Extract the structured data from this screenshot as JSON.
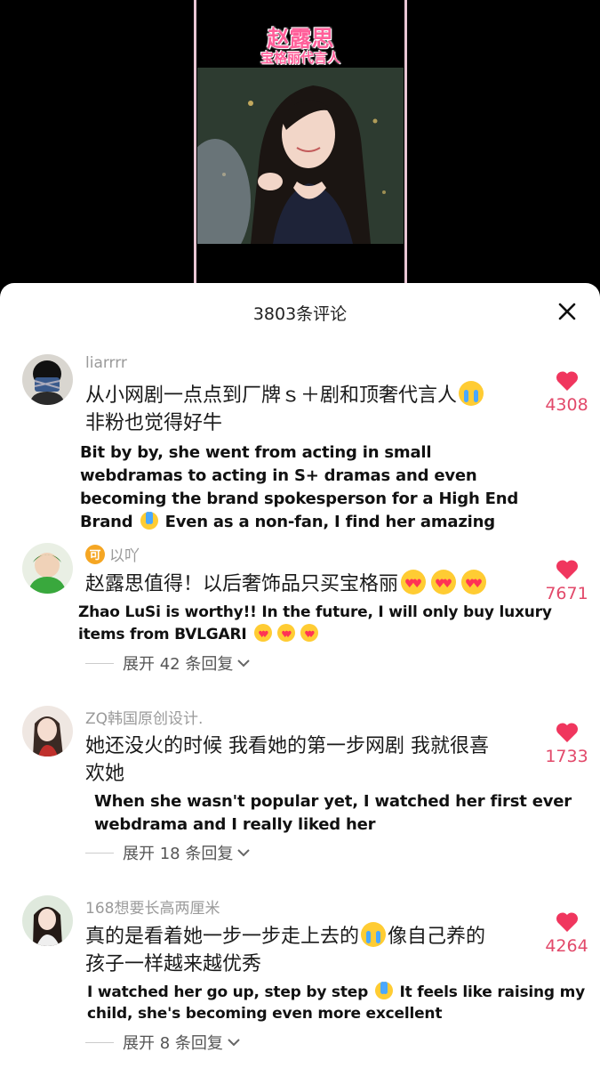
{
  "video": {
    "title": "赵露思",
    "subtitle": "宝格丽代言人"
  },
  "comments_sheet": {
    "title": "3803条评论",
    "close_icon": "close-icon"
  },
  "comments": [
    {
      "username": "liarrrr",
      "text_cn": "从小网剧一点点到厂牌ｓ＋剧和顶奢代言人",
      "text_cn_2": "非粉也觉得好牛",
      "translation_lines": [
        "Bit by by, she went from acting in small",
        "webdramas to acting in S+ dramas and even",
        "becoming the brand spokesperson for a High End",
        "Brand",
        "Even as a non-fan, I find her amazing"
      ],
      "likes": "4308"
    },
    {
      "badge": "可",
      "username": "以吖",
      "text_cn": "赵露思值得！以后奢饰品只买宝格丽",
      "translation_lines": [
        "Zhao LuSi is worthy!! In the future, I will only buy luxury",
        "items from BVLGARI"
      ],
      "likes": "7671",
      "replies": "展开 42 条回复"
    },
    {
      "username": "ZQ韩国原创设计.",
      "text_cn": "她还没火的时候 我看她的第一步网剧 我就很喜",
      "text_cn_2": "欢她",
      "translation_lines": [
        "When she wasn't popular yet, I watched her first ever",
        "webdrama and I really liked her"
      ],
      "likes": "1733",
      "replies": "展开 18 条回复"
    },
    {
      "username": "168想要长高两厘米",
      "text_cn": "真的是看着她一步一步走上去的",
      "text_cn_tail": "像自己养的",
      "text_cn_2": "孩子一样越来越优秀",
      "translation_lines": [
        "I watched her go up, step by step",
        "It feels like raising my",
        "child, she's becoming even more excellent"
      ],
      "likes": "4264",
      "replies": "展开 8 条回复"
    }
  ],
  "colors": {
    "accent_pink": "#ff5f9a",
    "like_red": "#e2496a",
    "username_gray": "#9a9a9a"
  }
}
